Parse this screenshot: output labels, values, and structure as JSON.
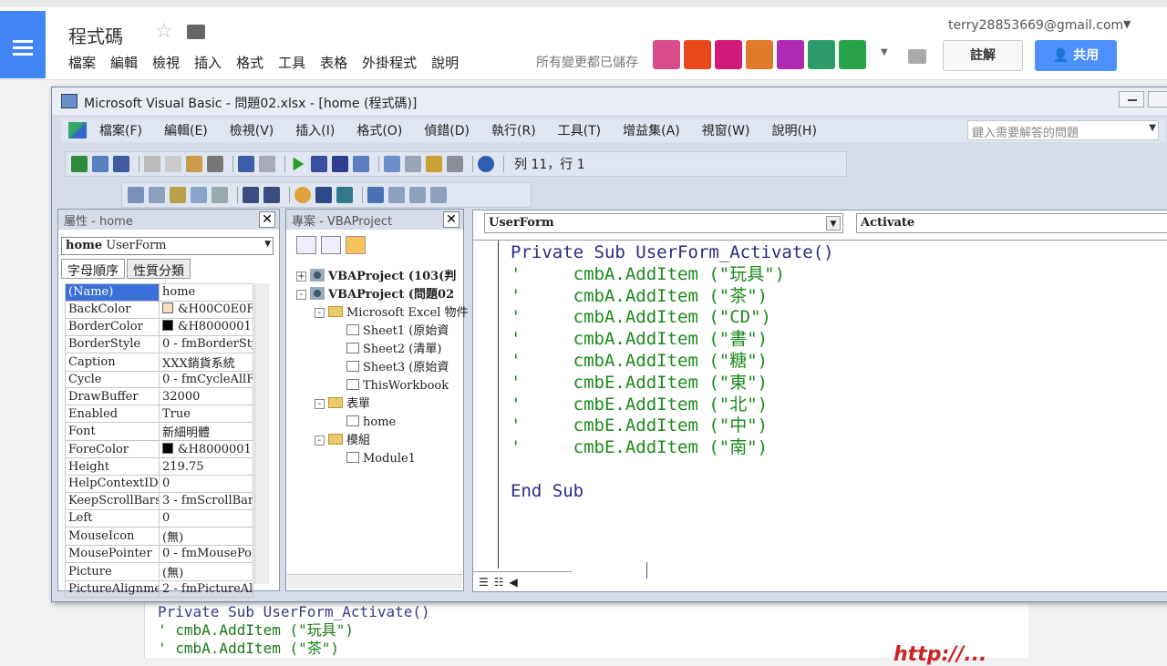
{
  "gdocs": {
    "doc_title": "程式碼",
    "menu": [
      "檔案",
      "編輯",
      "檢視",
      "插入",
      "格式",
      "工具",
      "表格",
      "外掛程式",
      "說明"
    ],
    "saved_status": "所有變更都已儲存",
    "account": "terry28853669@gmail.com",
    "comments_label": "註解",
    "share_label": "共用",
    "avatar_colors": [
      "#d94d8a",
      "#e8491c",
      "#cf1a7a",
      "#e07a2a",
      "#b02ab0",
      "#2e9c6a",
      "#27a34a"
    ]
  },
  "vbe": {
    "title": "Microsoft Visual Basic - 問題02.xlsx - [home (程式碼)]",
    "menu": [
      "檔案(F)",
      "編輯(E)",
      "檢視(V)",
      "插入(I)",
      "格式(O)",
      "偵錯(D)",
      "執行(R)",
      "工具(T)",
      "增益集(A)",
      "視窗(W)",
      "說明(H)"
    ],
    "ask_placeholder": "鍵入需要解答的問題",
    "cursor_pos": "列 11，行 1",
    "properties": {
      "title": "屬性 - home",
      "object_name": "home",
      "object_type": "UserForm",
      "tabs": [
        "字母順序",
        "性質分類"
      ],
      "rows": [
        {
          "k": "(Name)",
          "v": "home"
        },
        {
          "k": "BackColor",
          "v": "&H00C0E0F",
          "swatch": "#f6e0c8"
        },
        {
          "k": "BorderColor",
          "v": "&H8000001",
          "swatch": "#000000"
        },
        {
          "k": "BorderStyle",
          "v": "0 - fmBorderSty"
        },
        {
          "k": "Caption",
          "v": "XXX銷貨系統"
        },
        {
          "k": "Cycle",
          "v": "0 - fmCycleAllF"
        },
        {
          "k": "DrawBuffer",
          "v": "32000"
        },
        {
          "k": "Enabled",
          "v": "True"
        },
        {
          "k": "Font",
          "v": "新細明體"
        },
        {
          "k": "ForeColor",
          "v": "&H8000001",
          "swatch": "#000000"
        },
        {
          "k": "Height",
          "v": "219.75"
        },
        {
          "k": "HelpContextID",
          "v": "0"
        },
        {
          "k": "KeepScrollBarsVi",
          "v": "3 - fmScrollBars"
        },
        {
          "k": "Left",
          "v": "0"
        },
        {
          "k": "MouseIcon",
          "v": "(無)"
        },
        {
          "k": "MousePointer",
          "v": "0 - fmMousePoi"
        },
        {
          "k": "Picture",
          "v": "(無)"
        },
        {
          "k": "PictureAlignment",
          "v": "2 - fmPictureAli"
        }
      ]
    },
    "project": {
      "title": "專案 - VBAProject",
      "nodes": [
        {
          "label": "VBAProject (103(判",
          "bold": true
        },
        {
          "label": "VBAProject (問題02",
          "bold": true
        },
        {
          "label": "Microsoft Excel 物件"
        },
        {
          "label": "Sheet1 (原始資"
        },
        {
          "label": "Sheet2 (清單)"
        },
        {
          "label": "Sheet3 (原始資"
        },
        {
          "label": "ThisWorkbook"
        },
        {
          "label": "表單"
        },
        {
          "label": "home"
        },
        {
          "label": "模組"
        },
        {
          "label": "Module1"
        }
      ]
    },
    "code": {
      "object": "UserForm",
      "procedure": "Activate",
      "lines": [
        {
          "t": "kw",
          "s": "Private Sub UserForm_Activate()"
        },
        {
          "t": "cm",
          "s": "'     cmbA.AddItem (\"玩具\")"
        },
        {
          "t": "cm",
          "s": "'     cmbA.AddItem (\"茶\")"
        },
        {
          "t": "cm",
          "s": "'     cmbA.AddItem (\"CD\")"
        },
        {
          "t": "cm",
          "s": "'     cmbA.AddItem (\"書\")"
        },
        {
          "t": "cm",
          "s": "'     cmbA.AddItem (\"糖\")"
        },
        {
          "t": "cm",
          "s": "'     cmbE.AddItem (\"東\")"
        },
        {
          "t": "cm",
          "s": "'     cmbE.AddItem (\"北\")"
        },
        {
          "t": "cm",
          "s": "'     cmbE.AddItem (\"中\")"
        },
        {
          "t": "cm",
          "s": "'     cmbE.AddItem (\"南\")"
        },
        {
          "t": "kw",
          "s": ""
        },
        {
          "t": "kw",
          "s": "End Sub"
        }
      ]
    }
  },
  "background_doc": {
    "lines": [
      "Private Sub UserForm_Activate()",
      "'     cmbA.AddItem (\"玩具\")",
      "'     cmbA.AddItem (\"茶\")"
    ]
  },
  "watermark": "http://..."
}
